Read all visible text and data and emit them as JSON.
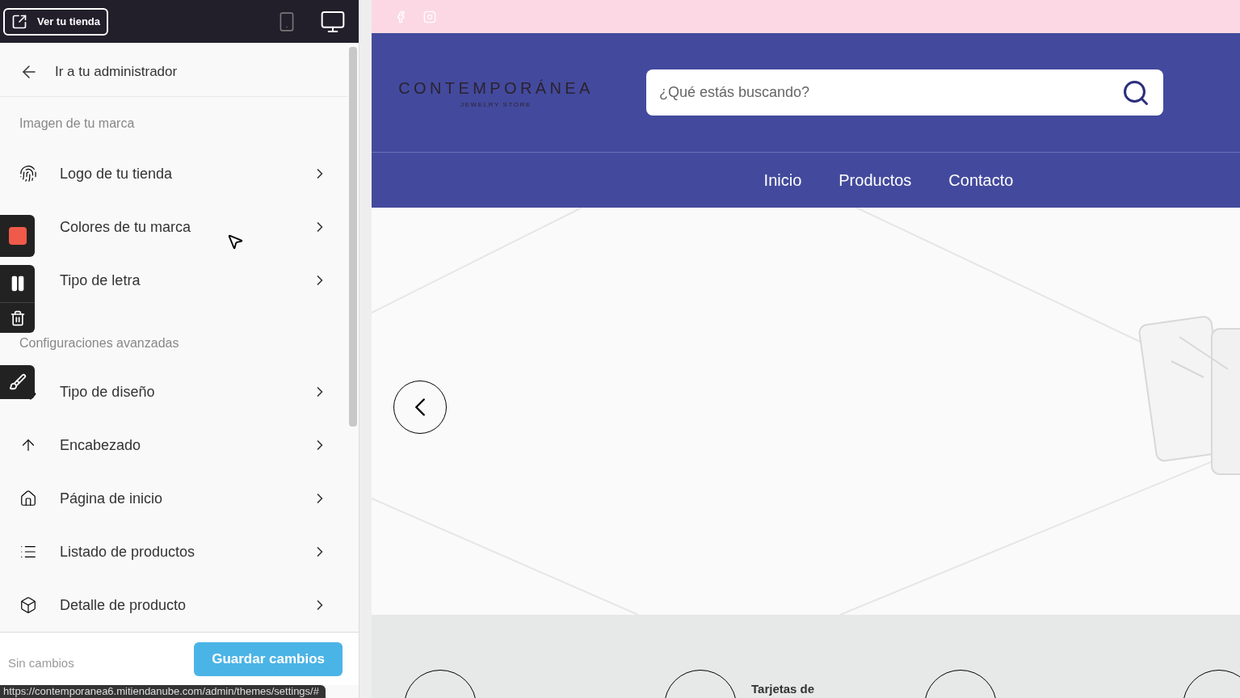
{
  "topbar": {
    "view_store": "Ver tu tienda",
    "devices": [
      {
        "kind": "mobile",
        "selected": false
      },
      {
        "kind": "desktop",
        "selected": true
      }
    ]
  },
  "sidebar": {
    "back": "Ir a tu administrador",
    "sections": [
      {
        "title": "Imagen de tu marca",
        "items": [
          {
            "label": "Logo de tu tienda"
          },
          {
            "label": "Colores de tu marca"
          },
          {
            "label": "Tipo de letra"
          }
        ]
      },
      {
        "title": "Configuraciones avanzadas",
        "items": [
          {
            "label": "Tipo de diseño"
          },
          {
            "label": "Encabezado"
          },
          {
            "label": "Página de inicio"
          },
          {
            "label": "Listado de productos"
          },
          {
            "label": "Detalle de producto"
          }
        ]
      }
    ],
    "status": "Sin cambios",
    "save": "Guardar cambios"
  },
  "store": {
    "logo": "CONTEMPORÁNEA",
    "tagline": "JEWELRY STORE",
    "search": {
      "placeholder": "¿Qué estás buscando?"
    },
    "nav": [
      "Inicio",
      "Productos",
      "Contacto"
    ],
    "features": [
      {
        "label": "Tarjetas de"
      }
    ]
  },
  "status_bar": "https://contemporanea6.mitiendanube.com/admin/themes/settings/#"
}
